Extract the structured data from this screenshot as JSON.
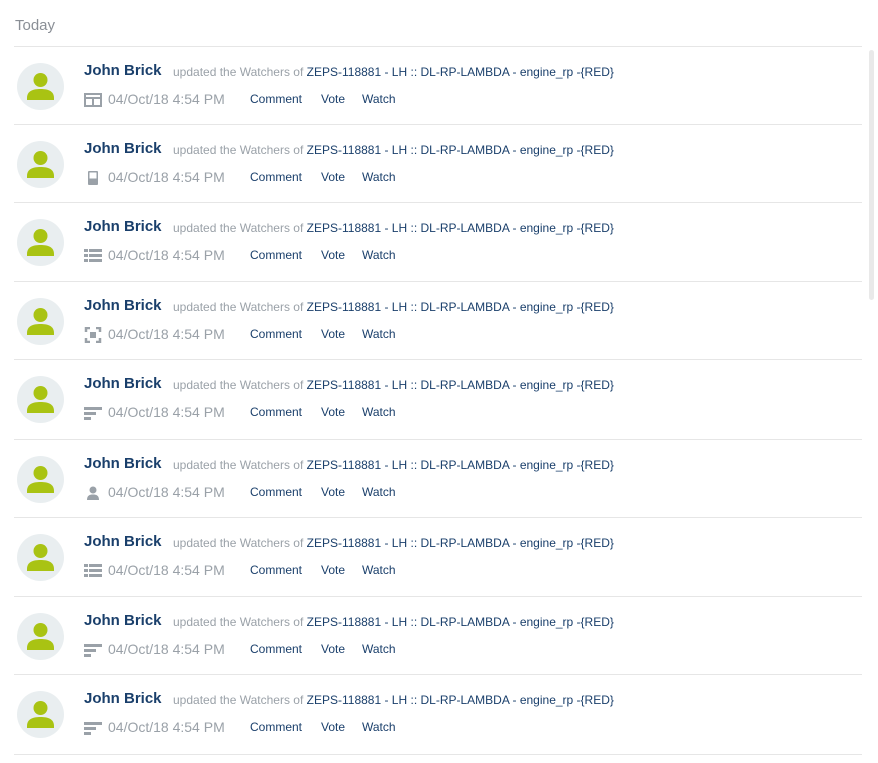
{
  "section": {
    "title": "Today"
  },
  "colors": {
    "avatar_green": "#a9c313",
    "avatar_bg": "#e9eef0",
    "link": "#1a3f6b",
    "muted": "#9aa1a8"
  },
  "items": [
    {
      "user": "John Brick",
      "action": "updated the Watchers of",
      "issue": "ZEPS-118881 - LH :: DL-RP-LAMBDA - engine_rp -{RED}",
      "time": "04/Oct/18 4:54 PM",
      "type_icon": "layout-icon",
      "comment": "Comment",
      "vote": "Vote",
      "watch": "Watch"
    },
    {
      "user": "John Brick",
      "action": "updated the Watchers of",
      "issue": "ZEPS-118881 - LH :: DL-RP-LAMBDA - engine_rp -{RED}",
      "time": "04/Oct/18 4:54 PM",
      "type_icon": "document-icon",
      "comment": "Comment",
      "vote": "Vote",
      "watch": "Watch"
    },
    {
      "user": "John Brick",
      "action": "updated the Watchers of",
      "issue": "ZEPS-118881 - LH :: DL-RP-LAMBDA - engine_rp -{RED}",
      "time": "04/Oct/18 4:54 PM",
      "type_icon": "list-icon",
      "comment": "Comment",
      "vote": "Vote",
      "watch": "Watch"
    },
    {
      "user": "John Brick",
      "action": "updated the Watchers of",
      "issue": "ZEPS-118881 - LH :: DL-RP-LAMBDA - engine_rp -{RED}",
      "time": "04/Oct/18 4:54 PM",
      "type_icon": "focus-icon",
      "comment": "Comment",
      "vote": "Vote",
      "watch": "Watch"
    },
    {
      "user": "John Brick",
      "action": "updated the Watchers of",
      "issue": "ZEPS-118881 - LH :: DL-RP-LAMBDA - engine_rp -{RED}",
      "time": "04/Oct/18 4:54 PM",
      "type_icon": "text-lines-icon",
      "comment": "Comment",
      "vote": "Vote",
      "watch": "Watch"
    },
    {
      "user": "John Brick",
      "action": "updated the Watchers of",
      "issue": "ZEPS-118881 - LH :: DL-RP-LAMBDA - engine_rp -{RED}",
      "time": "04/Oct/18 4:54 PM",
      "type_icon": "user-icon",
      "comment": "Comment",
      "vote": "Vote",
      "watch": "Watch"
    },
    {
      "user": "John Brick",
      "action": "updated the Watchers of",
      "issue": "ZEPS-118881 - LH :: DL-RP-LAMBDA - engine_rp -{RED}",
      "time": "04/Oct/18 4:54 PM",
      "type_icon": "list-icon",
      "comment": "Comment",
      "vote": "Vote",
      "watch": "Watch"
    },
    {
      "user": "John Brick",
      "action": "updated the Watchers of",
      "issue": "ZEPS-118881 - LH :: DL-RP-LAMBDA - engine_rp -{RED}",
      "time": "04/Oct/18 4:54 PM",
      "type_icon": "text-lines-icon",
      "comment": "Comment",
      "vote": "Vote",
      "watch": "Watch"
    },
    {
      "user": "John Brick",
      "action": "updated the Watchers of",
      "issue": "ZEPS-118881 - LH :: DL-RP-LAMBDA - engine_rp -{RED}",
      "time": "04/Oct/18 4:54 PM",
      "type_icon": "text-lines-icon",
      "comment": "Comment",
      "vote": "Vote",
      "watch": "Watch"
    }
  ]
}
